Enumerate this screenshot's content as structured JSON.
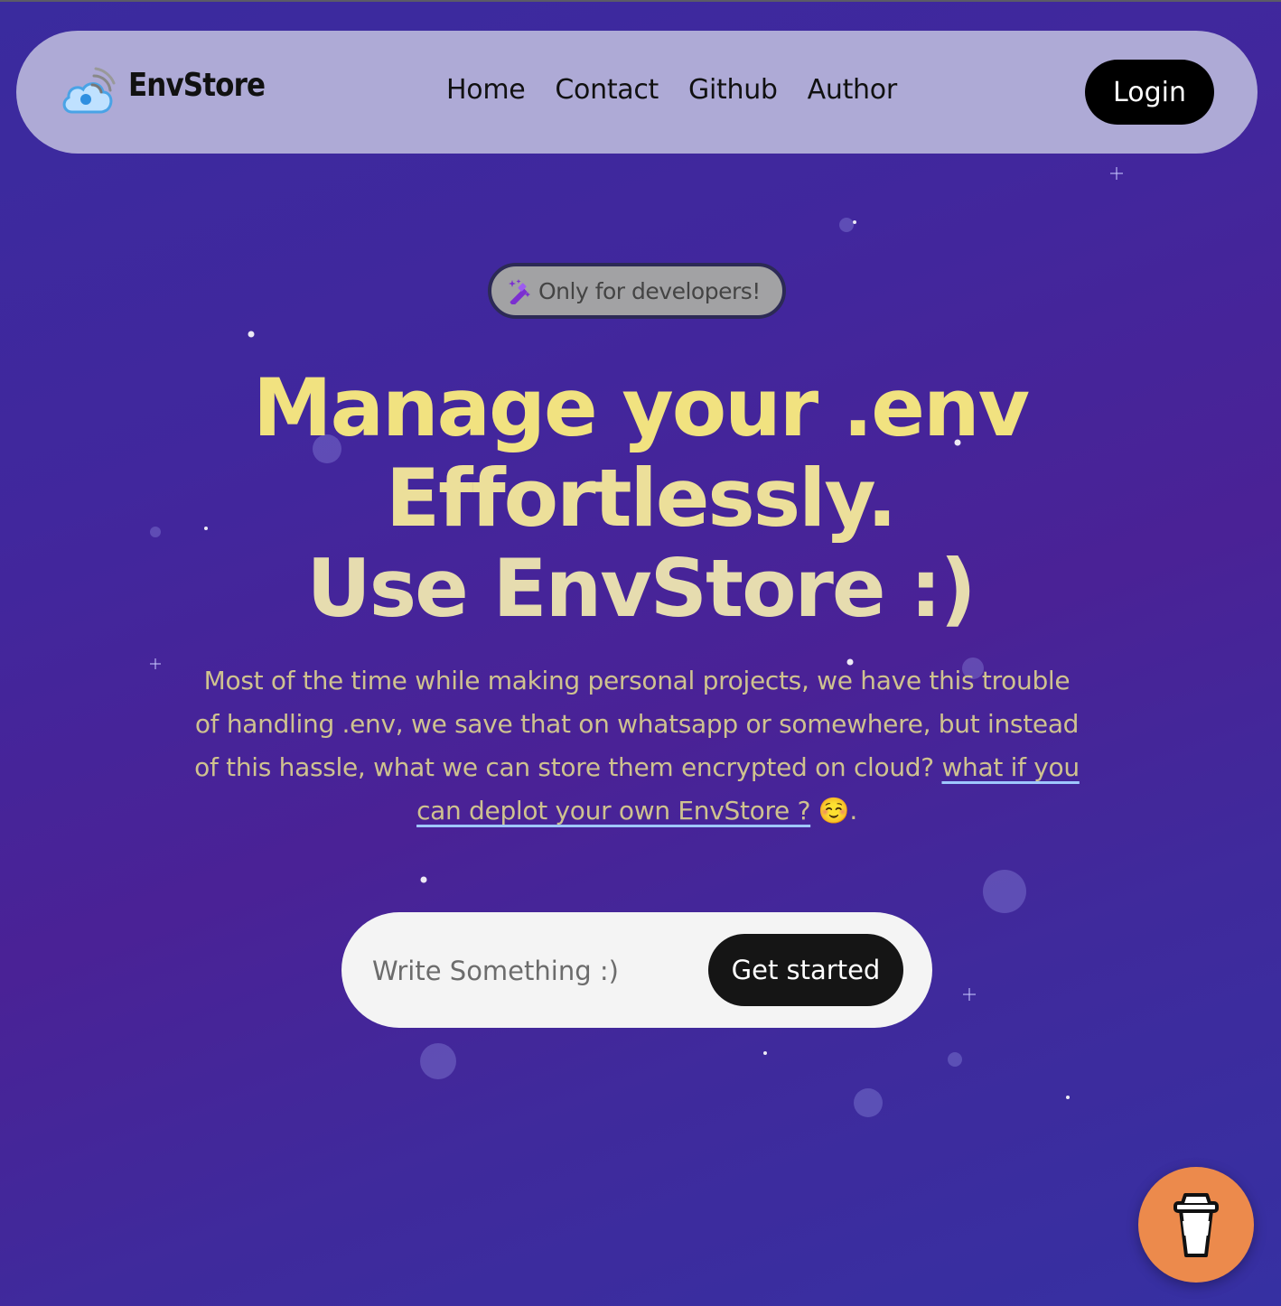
{
  "navbar": {
    "brand": "EnvStore",
    "links": [
      "Home",
      "Contact",
      "Github",
      "Author"
    ],
    "login_label": "Login"
  },
  "badge": {
    "icon": "magic-wand-icon",
    "text": "Only for developers!"
  },
  "hero": {
    "headline_line1": "Manage your .env",
    "headline_line2": "Effortlessly.",
    "headline_line3": "Use EnvStore :)",
    "description": "Most of the time while making personal projects, we have this trouble of handling .env, we save that on whatsapp or somewhere, but instead of this hassle, what we can store them encrypted on cloud? ",
    "description_link": "what if you can deplot your own EnvStore ?",
    "description_emoji": "☺️",
    "description_end": "."
  },
  "cta": {
    "input_placeholder": "Write Something :)",
    "input_value": "",
    "button_label": "Get started"
  },
  "floating_button": {
    "icon": "coffee-cup-icon"
  },
  "colors": {
    "background_start": "#3a2b9e",
    "background_mid": "#4a2296",
    "navbar": "#aeaad6",
    "headline": "#f1e280",
    "description": "#cfc28f",
    "coffee_button": "#ec8a4c",
    "dark_button": "#000000"
  }
}
